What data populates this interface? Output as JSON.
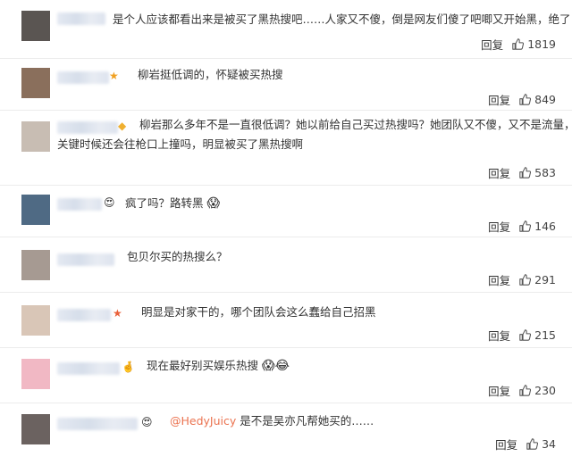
{
  "actions": {
    "reply_label": "回复"
  },
  "comments": [
    {
      "text": "是个人应该都看出来是被买了黑热搜吧……人家又不傻，倒是网友们傻了吧唧又开始黑，绝了",
      "likes": "1819"
    },
    {
      "text": "柳岩挺低调的，怀疑被买热搜",
      "likes": "849"
    },
    {
      "text": "柳岩那么多年不是一直很低调？她以前给自己买过热搜吗？她团队又不傻，又不是流量，",
      "text2": "关键时候还会往枪口上撞吗，明显被买了黑热搜啊",
      "likes": "583"
    },
    {
      "text": "疯了吗？路转黑",
      "emoji": "😱",
      "likes": "146"
    },
    {
      "text": "包贝尔买的热搜么？",
      "likes": "291"
    },
    {
      "text": "明显是对家干的，哪个团队会这么蠢给自己招黑",
      "likes": "215"
    },
    {
      "text": "现在最好别买娱乐热搜",
      "emoji": "😱😂",
      "likes": "230"
    },
    {
      "mention": "@HedyJuicy",
      "text": "是不是吴亦凡帮她买的……",
      "likes": "34"
    }
  ]
}
